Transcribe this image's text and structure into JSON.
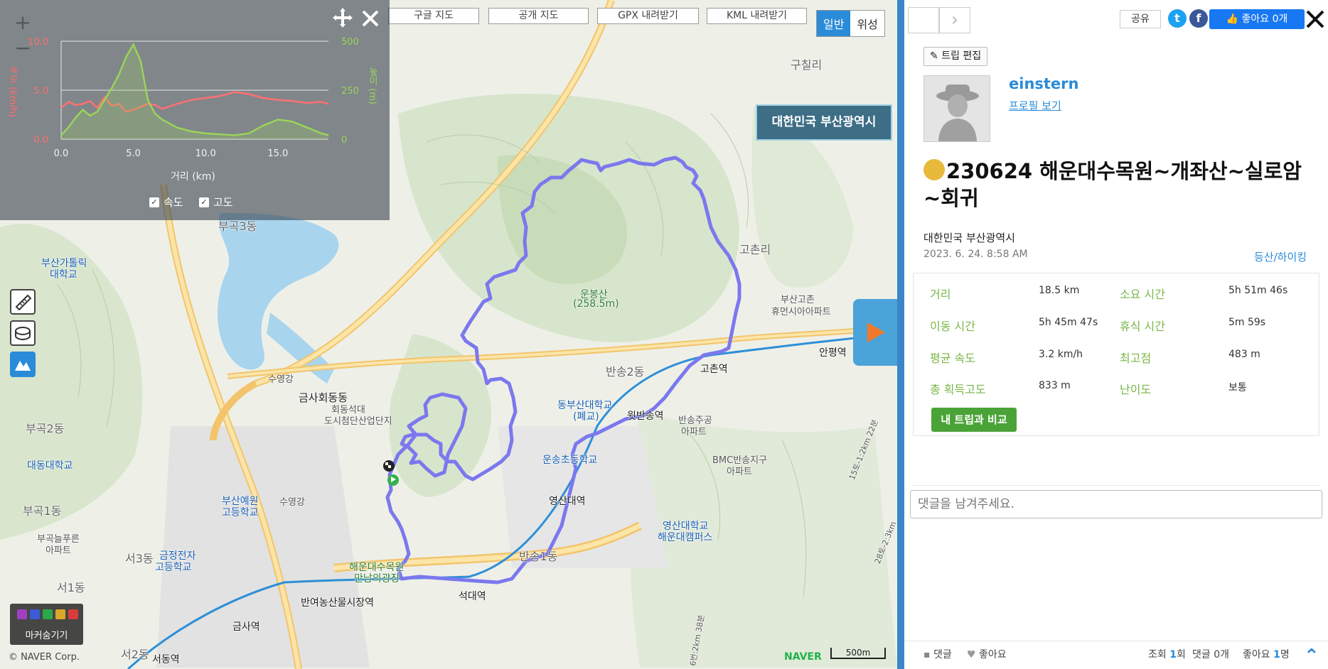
{
  "map": {
    "buttons": [
      "구글 지도",
      "공개 지도",
      "GPX 내려받기",
      "KML 내려받기"
    ],
    "maptype": {
      "normal": "일반",
      "satellite": "위성"
    },
    "location_box": "대한민국 부산광역시",
    "marker_toggle": "마커숨기기",
    "copyright": "© NAVER Corp.",
    "naver_logo": "NAVER",
    "scale": "500m",
    "zoom_in": "+",
    "zoom_out": "−",
    "labels": {
      "guchilli": "구칠리",
      "gochonri": "고촌리",
      "ungbongsan": "운봉산",
      "ungbongsan_h": "(258.5m)",
      "bansong2": "반송2동",
      "gochon_station": "고촌역",
      "anpyeong": "안평역",
      "busan_gochon": "부산고촌",
      "hyumeonsia": "휴먼시아아파트",
      "dongbusan_univ": "동부산대학교",
      "dongbusan_univ2": "(폐교)",
      "witbansong": "윗반송역",
      "bansong_apt": "반송주공",
      "bansong_apt2": "아파트",
      "bmc": "BMC반송지구",
      "bmc2": "아파트",
      "unsong_elem": "운송초등학교",
      "yeongsan_station": "영산대역",
      "yeongsan_univ": "영산대학교",
      "yeongsan_univ2": "해운대캠퍼스",
      "bansong1": "반송1동",
      "seokdae": "석대역",
      "haeundae_arbor": "해운대수목원",
      "mannam": "만남의광장",
      "banyeo_market": "반여농산물시장역",
      "geumsa": "금사역",
      "seodong": "서동역",
      "seo3dong": "서3동",
      "seo1dong": "서1동",
      "seo2dong": "서2동",
      "geumjeong_elec": "금정전자",
      "geumjeong_elec2": "고등학교",
      "geumsahoedong": "금사회동동",
      "hoedong": "회동석대",
      "hoedong2": "도시첨단산업단지",
      "suyeonggang1": "수영강",
      "suyeonggang2": "수영강",
      "bugok3": "부곡3동",
      "bugok2": "부곡2동",
      "bugok1": "부곡1동",
      "bugok_apt": "부곡늘푸른",
      "bugok_apt2": "아파트",
      "catholic_univ": "부산가톨릭",
      "catholic_univ2": "대학교",
      "daedong_univ": "대동대학교",
      "busan_yeasul": "부산예원",
      "busan_yeasul2": "고등학교",
      "road_right1": "15토-1:2km 22분",
      "road_right2": "28토-2:3km",
      "bottom_road": "6번:2km 38분"
    }
  },
  "chart": {
    "title_left": "속도 (km/h)",
    "title_right": "높이 (m)",
    "xlabel": "거리 (km)",
    "legend_speed": "속도",
    "legend_alt": "고도",
    "chart_data": {
      "type": "line",
      "xlabel": "거리 (km)",
      "x_ticks": [
        0.0,
        5.0,
        10.0,
        15.0
      ],
      "y_left_ticks": [
        0.0,
        5.0,
        10.0
      ],
      "y_right_ticks": [
        0,
        250,
        500
      ],
      "xlim": [
        0,
        18.5
      ],
      "y_left_lim": [
        0,
        10
      ],
      "y_right_lim": [
        0,
        500
      ],
      "grid": true,
      "series": [
        {
          "name": "속도",
          "color": "#ff7070",
          "axis": "left",
          "x": [
            0,
            0.5,
            1,
            1.5,
            2,
            2.5,
            3,
            3.5,
            4,
            4.5,
            5,
            5.5,
            6,
            6.5,
            7,
            8,
            9,
            10,
            11,
            12,
            13,
            14,
            15,
            16,
            17,
            18,
            18.5
          ],
          "y": [
            3.2,
            3.8,
            3.5,
            3.6,
            3.9,
            3.2,
            4.3,
            3.4,
            3.6,
            2.8,
            3.0,
            3.3,
            3.6,
            3.5,
            3.1,
            3.6,
            4.0,
            4.2,
            4.4,
            4.8,
            4.6,
            4.2,
            4.0,
            3.9,
            3.7,
            3.8,
            3.6
          ]
        },
        {
          "name": "고도",
          "color": "#9ad45a",
          "axis": "right",
          "x": [
            0,
            0.5,
            1,
            1.5,
            2,
            2.5,
            3,
            3.5,
            4,
            4.5,
            5,
            5.5,
            6,
            6.5,
            7,
            8,
            9,
            10,
            11,
            12,
            13,
            14,
            15,
            16,
            17,
            18,
            18.5
          ],
          "y": [
            20,
            60,
            110,
            150,
            120,
            140,
            200,
            260,
            330,
            420,
            483,
            400,
            200,
            130,
            100,
            60,
            40,
            30,
            25,
            20,
            30,
            70,
            100,
            90,
            60,
            30,
            20
          ]
        }
      ]
    }
  },
  "side": {
    "share": "공유",
    "twitter": "t",
    "facebook": "f",
    "like": "좋아요 0개",
    "edit_trip": "트립 편집",
    "username": "einstern",
    "profile_link": "프로필 보기",
    "title": "230624 해운대수목원~개좌산~실로암~회귀",
    "location": "대한민국 부산광역시",
    "date": "2023. 6. 24. 8:58 AM",
    "category": "등산/하이킹",
    "stats": [
      {
        "label": "거리",
        "value": "18.5 km",
        "label2": "소요 시간",
        "value2": "5h 51m 46s"
      },
      {
        "label": "이동 시간",
        "value": "5h 45m 47s",
        "label2": "휴식 시간",
        "value2": "5m 59s"
      },
      {
        "label": "평균 속도",
        "value": "3.2 km/h",
        "label2": "최고점",
        "value2": "483 m"
      },
      {
        "label": "총 획득고도",
        "value": "833 m",
        "label2": "난이도",
        "value2": "보통"
      }
    ],
    "compare_btn": "내 트립과 비교",
    "comment_placeholder": "댓글을 남겨주세요.",
    "footer": {
      "comment": "댓글",
      "like": "좋아요",
      "views_label": "조회",
      "views": "1",
      "views_unit": "회",
      "comments_label": "댓글",
      "comments_count": "0개",
      "likes_label": "좋아요",
      "likes_count": "1",
      "likes_unit": "명"
    }
  },
  "colors": {
    "accent": "#2a8bd8",
    "route": "#7b78ee",
    "green": "#7ab646"
  }
}
